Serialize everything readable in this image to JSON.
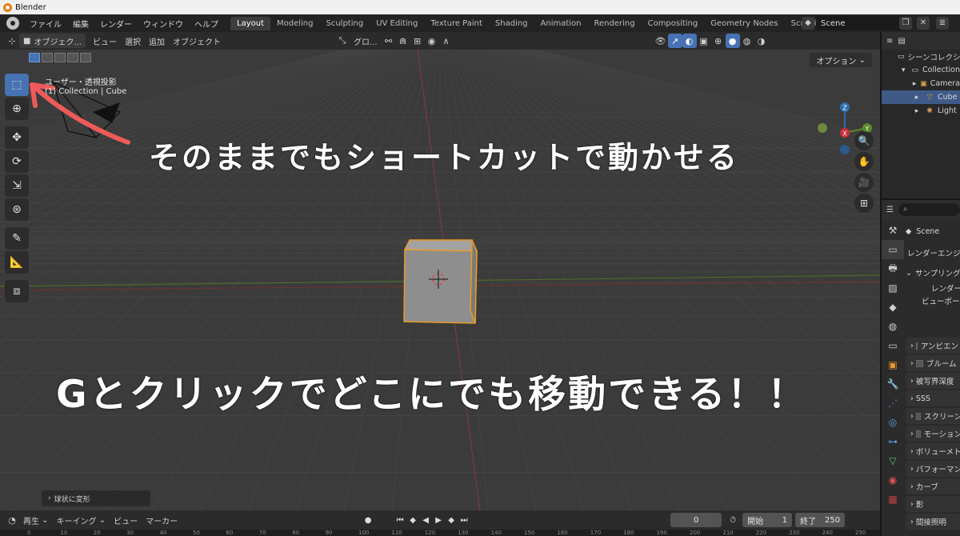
{
  "os": {
    "title": "Blender"
  },
  "topbar": {
    "menus": [
      "ファイル",
      "編集",
      "レンダー",
      "ウィンドウ",
      "ヘルプ"
    ],
    "workspaces": [
      "Layout",
      "Modeling",
      "Sculpting",
      "UV Editing",
      "Texture Paint",
      "Shading",
      "Animation",
      "Rendering",
      "Compositing",
      "Geometry Nodes",
      "Scripting"
    ],
    "active_workspace": "Layout",
    "scene": "Scene"
  },
  "viewport_header": {
    "mode": "オブジェク...",
    "menus": [
      "ビュー",
      "選択",
      "追加",
      "オブジェクト"
    ],
    "orientation": "グロ...",
    "options": "オプション"
  },
  "viewport": {
    "view_name": "ユーザー・透視投影",
    "collection_info": "(1) Collection | Cube",
    "last_operator": "球状に変形",
    "accent": "#4772b3",
    "selection_outline": "#e89b2a"
  },
  "gizmo": {
    "z": "Z",
    "x": "X",
    "y": "Y"
  },
  "annotations": {
    "line1": "そのままでもショートカットで動かせる",
    "line2": "Gとクリックでどこにでも移動できる！！"
  },
  "timeline": {
    "menus": [
      "再生",
      "キーイング",
      "ビュー",
      "マーカー"
    ],
    "current_frame": "0",
    "start_label": "開始",
    "start": "1",
    "end_label": "終了",
    "end": "250",
    "ruler": [
      "0",
      "10",
      "20",
      "30",
      "40",
      "50",
      "60",
      "70",
      "80",
      "90",
      "100",
      "110",
      "120",
      "130",
      "140",
      "150",
      "160",
      "170",
      "180",
      "190",
      "200",
      "210",
      "220",
      "230",
      "240",
      "250"
    ]
  },
  "outliner": {
    "rows": [
      {
        "label": "シーンコレクション",
        "icon": "scene-collection-icon"
      },
      {
        "label": "Collection",
        "icon": "collection-icon"
      },
      {
        "label": "Camera",
        "icon": "camera-icon"
      },
      {
        "label": "Cube",
        "icon": "mesh-icon"
      },
      {
        "label": "Light",
        "icon": "light-icon"
      }
    ]
  },
  "properties": {
    "scene": "Scene",
    "render_engine": "レンダーエンジン",
    "sampling": "サンプリング",
    "render": "レンダー",
    "viewport": "ビューポート",
    "panels": [
      "アンビエント",
      "ブルーム",
      "被写界深度",
      "SSS",
      "スクリーン",
      "モーション",
      "ボリューメトリック",
      "パフォーマンス",
      "カーブ",
      "影",
      "間接照明"
    ]
  }
}
